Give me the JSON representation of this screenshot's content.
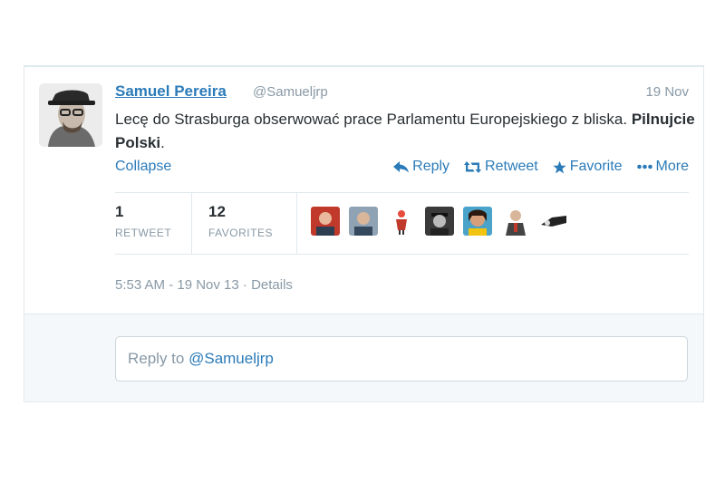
{
  "tweet": {
    "author_name": "Samuel Pereira",
    "author_handle": "@Samueljrp",
    "date": "19 Nov",
    "text_plain": "Lecę do Strasburga obserwować prace Parlamentu Europejskiego z bliska. ",
    "text_bold": "Pilnujcie Polski",
    "text_end": ".",
    "collapse_label": "Collapse",
    "actions": {
      "reply": "Reply",
      "retweet": "Retweet",
      "favorite": "Favorite",
      "more": "More"
    },
    "stats": {
      "retweets_count": "1",
      "retweets_label": "RETWEET",
      "favorites_count": "12",
      "favorites_label": "FAVORITES"
    },
    "meta": "5:53 AM - 19 Nov 13 · Details"
  },
  "reply": {
    "prefix": "Reply to ",
    "mention": "@Samueljrp"
  },
  "colors": {
    "link": "#2b7bb9",
    "muted": "#8899a6",
    "text": "#292f33"
  }
}
